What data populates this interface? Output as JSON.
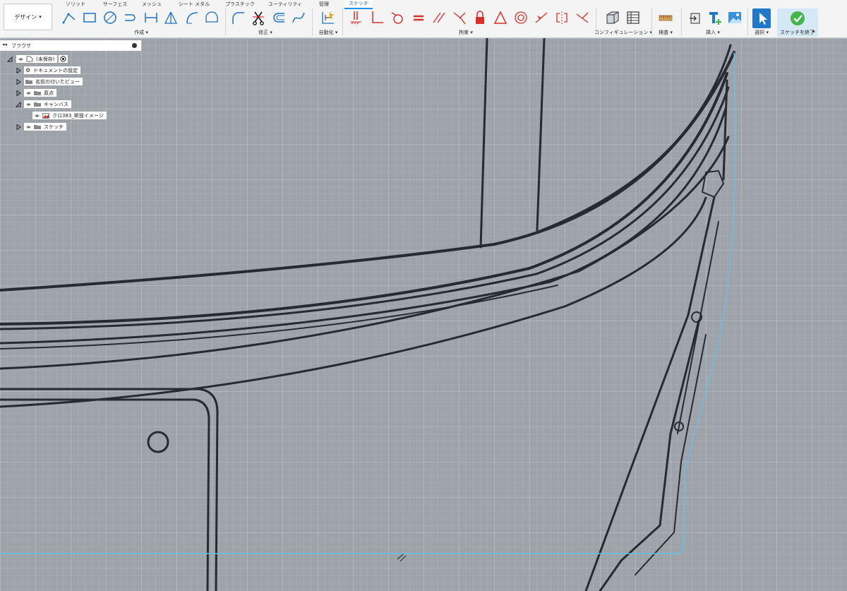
{
  "toolbar": {
    "workspace_label": "デザイン",
    "tabs": [
      "ソリッド",
      "サーフェス",
      "メッシュ",
      "シート メタル",
      "プラスチック",
      "ユーティリティ",
      "管理",
      "スケッチ"
    ],
    "groups": {
      "create": "作成",
      "modify": "修正",
      "automate": "自動化",
      "constraints": "拘束",
      "configure": "コンフィギュレーション",
      "inspect": "検査",
      "insert": "挿入",
      "select": "選択",
      "finish": "スケッチを終了"
    }
  },
  "browser": {
    "title": "ブラウザ",
    "items": [
      {
        "label": "(未保存)"
      },
      {
        "label": "ドキュメントの設定"
      },
      {
        "label": "名前の付いたビュー"
      },
      {
        "label": "原点"
      },
      {
        "label": "キャンバス"
      },
      {
        "label": "クロ383_断面イメージ"
      },
      {
        "label": "スケッチ"
      }
    ]
  },
  "colors": {
    "accent": "#1f8ef1",
    "canvas_bg": "#9ea3a9",
    "sketch_line": "#5fc1ee",
    "ink": "#262b31",
    "constraint_red": "#d9302a",
    "finish_green": "#43b649"
  }
}
